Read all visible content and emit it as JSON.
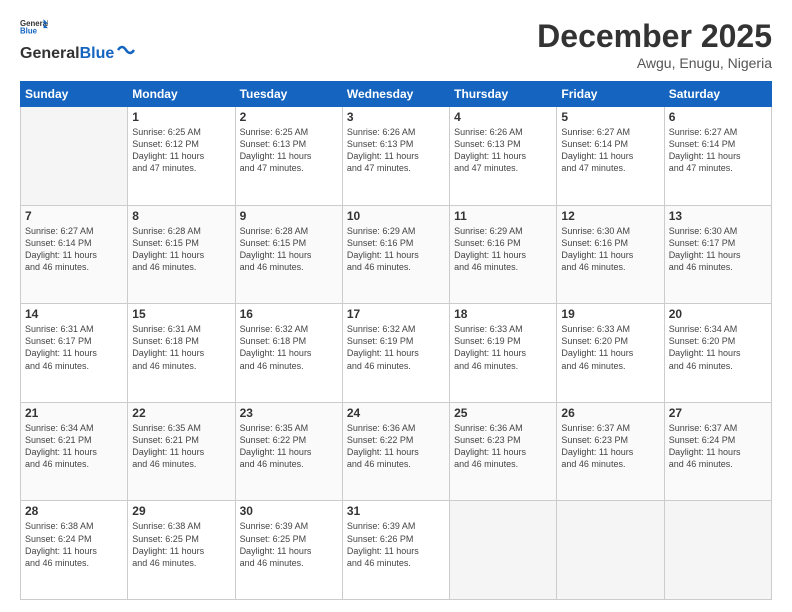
{
  "header": {
    "logo_general": "General",
    "logo_blue": "Blue",
    "month": "December 2025",
    "location": "Awgu, Enugu, Nigeria"
  },
  "weekdays": [
    "Sunday",
    "Monday",
    "Tuesday",
    "Wednesday",
    "Thursday",
    "Friday",
    "Saturday"
  ],
  "weeks": [
    [
      {
        "day": "",
        "info": ""
      },
      {
        "day": "1",
        "info": "Sunrise: 6:25 AM\nSunset: 6:12 PM\nDaylight: 11 hours\nand 47 minutes."
      },
      {
        "day": "2",
        "info": "Sunrise: 6:25 AM\nSunset: 6:13 PM\nDaylight: 11 hours\nand 47 minutes."
      },
      {
        "day": "3",
        "info": "Sunrise: 6:26 AM\nSunset: 6:13 PM\nDaylight: 11 hours\nand 47 minutes."
      },
      {
        "day": "4",
        "info": "Sunrise: 6:26 AM\nSunset: 6:13 PM\nDaylight: 11 hours\nand 47 minutes."
      },
      {
        "day": "5",
        "info": "Sunrise: 6:27 AM\nSunset: 6:14 PM\nDaylight: 11 hours\nand 47 minutes."
      },
      {
        "day": "6",
        "info": "Sunrise: 6:27 AM\nSunset: 6:14 PM\nDaylight: 11 hours\nand 47 minutes."
      }
    ],
    [
      {
        "day": "7",
        "info": "Sunrise: 6:27 AM\nSunset: 6:14 PM\nDaylight: 11 hours\nand 46 minutes."
      },
      {
        "day": "8",
        "info": "Sunrise: 6:28 AM\nSunset: 6:15 PM\nDaylight: 11 hours\nand 46 minutes."
      },
      {
        "day": "9",
        "info": "Sunrise: 6:28 AM\nSunset: 6:15 PM\nDaylight: 11 hours\nand 46 minutes."
      },
      {
        "day": "10",
        "info": "Sunrise: 6:29 AM\nSunset: 6:16 PM\nDaylight: 11 hours\nand 46 minutes."
      },
      {
        "day": "11",
        "info": "Sunrise: 6:29 AM\nSunset: 6:16 PM\nDaylight: 11 hours\nand 46 minutes."
      },
      {
        "day": "12",
        "info": "Sunrise: 6:30 AM\nSunset: 6:16 PM\nDaylight: 11 hours\nand 46 minutes."
      },
      {
        "day": "13",
        "info": "Sunrise: 6:30 AM\nSunset: 6:17 PM\nDaylight: 11 hours\nand 46 minutes."
      }
    ],
    [
      {
        "day": "14",
        "info": "Sunrise: 6:31 AM\nSunset: 6:17 PM\nDaylight: 11 hours\nand 46 minutes."
      },
      {
        "day": "15",
        "info": "Sunrise: 6:31 AM\nSunset: 6:18 PM\nDaylight: 11 hours\nand 46 minutes."
      },
      {
        "day": "16",
        "info": "Sunrise: 6:32 AM\nSunset: 6:18 PM\nDaylight: 11 hours\nand 46 minutes."
      },
      {
        "day": "17",
        "info": "Sunrise: 6:32 AM\nSunset: 6:19 PM\nDaylight: 11 hours\nand 46 minutes."
      },
      {
        "day": "18",
        "info": "Sunrise: 6:33 AM\nSunset: 6:19 PM\nDaylight: 11 hours\nand 46 minutes."
      },
      {
        "day": "19",
        "info": "Sunrise: 6:33 AM\nSunset: 6:20 PM\nDaylight: 11 hours\nand 46 minutes."
      },
      {
        "day": "20",
        "info": "Sunrise: 6:34 AM\nSunset: 6:20 PM\nDaylight: 11 hours\nand 46 minutes."
      }
    ],
    [
      {
        "day": "21",
        "info": "Sunrise: 6:34 AM\nSunset: 6:21 PM\nDaylight: 11 hours\nand 46 minutes."
      },
      {
        "day": "22",
        "info": "Sunrise: 6:35 AM\nSunset: 6:21 PM\nDaylight: 11 hours\nand 46 minutes."
      },
      {
        "day": "23",
        "info": "Sunrise: 6:35 AM\nSunset: 6:22 PM\nDaylight: 11 hours\nand 46 minutes."
      },
      {
        "day": "24",
        "info": "Sunrise: 6:36 AM\nSunset: 6:22 PM\nDaylight: 11 hours\nand 46 minutes."
      },
      {
        "day": "25",
        "info": "Sunrise: 6:36 AM\nSunset: 6:23 PM\nDaylight: 11 hours\nand 46 minutes."
      },
      {
        "day": "26",
        "info": "Sunrise: 6:37 AM\nSunset: 6:23 PM\nDaylight: 11 hours\nand 46 minutes."
      },
      {
        "day": "27",
        "info": "Sunrise: 6:37 AM\nSunset: 6:24 PM\nDaylight: 11 hours\nand 46 minutes."
      }
    ],
    [
      {
        "day": "28",
        "info": "Sunrise: 6:38 AM\nSunset: 6:24 PM\nDaylight: 11 hours\nand 46 minutes."
      },
      {
        "day": "29",
        "info": "Sunrise: 6:38 AM\nSunset: 6:25 PM\nDaylight: 11 hours\nand 46 minutes."
      },
      {
        "day": "30",
        "info": "Sunrise: 6:39 AM\nSunset: 6:25 PM\nDaylight: 11 hours\nand 46 minutes."
      },
      {
        "day": "31",
        "info": "Sunrise: 6:39 AM\nSunset: 6:26 PM\nDaylight: 11 hours\nand 46 minutes."
      },
      {
        "day": "",
        "info": ""
      },
      {
        "day": "",
        "info": ""
      },
      {
        "day": "",
        "info": ""
      }
    ]
  ]
}
